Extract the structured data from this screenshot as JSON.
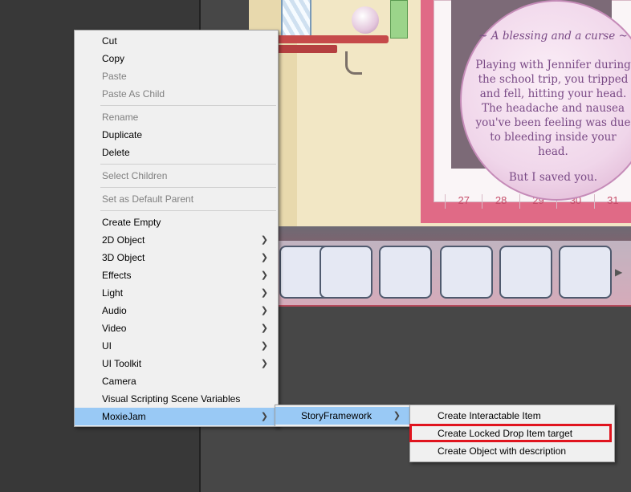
{
  "scene": {
    "calendar_days": [
      "27",
      "28",
      "29",
      "30",
      "31"
    ],
    "blessing": {
      "title": "~ A blessing and a curse ~",
      "body": "Playing with Jennifer during the school trip, you tripped and fell, hitting your head. The headache and nausea you've been feeling was due to bleeding inside your head.",
      "closing": "But I saved you."
    }
  },
  "context_menu": {
    "items": [
      {
        "label": "Cut",
        "enabled": true,
        "submenu": false
      },
      {
        "label": "Copy",
        "enabled": true,
        "submenu": false
      },
      {
        "label": "Paste",
        "enabled": false,
        "submenu": false
      },
      {
        "label": "Paste As Child",
        "enabled": false,
        "submenu": false
      },
      {
        "separator": true
      },
      {
        "label": "Rename",
        "enabled": false,
        "submenu": false
      },
      {
        "label": "Duplicate",
        "enabled": true,
        "submenu": false
      },
      {
        "label": "Delete",
        "enabled": true,
        "submenu": false
      },
      {
        "separator": true
      },
      {
        "label": "Select Children",
        "enabled": false,
        "submenu": false
      },
      {
        "separator": true
      },
      {
        "label": "Set as Default Parent",
        "enabled": false,
        "submenu": false
      },
      {
        "separator": true
      },
      {
        "label": "Create Empty",
        "enabled": true,
        "submenu": false
      },
      {
        "label": "2D Object",
        "enabled": true,
        "submenu": true
      },
      {
        "label": "3D Object",
        "enabled": true,
        "submenu": true
      },
      {
        "label": "Effects",
        "enabled": true,
        "submenu": true
      },
      {
        "label": "Light",
        "enabled": true,
        "submenu": true
      },
      {
        "label": "Audio",
        "enabled": true,
        "submenu": true
      },
      {
        "label": "Video",
        "enabled": true,
        "submenu": true
      },
      {
        "label": "UI",
        "enabled": true,
        "submenu": true
      },
      {
        "label": "UI Toolkit",
        "enabled": true,
        "submenu": true
      },
      {
        "label": "Camera",
        "enabled": true,
        "submenu": false
      },
      {
        "label": "Visual Scripting Scene Variables",
        "enabled": true,
        "submenu": false
      },
      {
        "label": "MoxieJam",
        "enabled": true,
        "submenu": true,
        "active": true
      }
    ]
  },
  "submenu_moxiejam": {
    "items": [
      {
        "label": "StoryFramework",
        "enabled": true,
        "submenu": true,
        "active": true
      }
    ]
  },
  "submenu_storyframework": {
    "items": [
      {
        "label": "Create Interactable Item",
        "enabled": true,
        "submenu": false
      },
      {
        "label": "Create Locked Drop Item target",
        "enabled": true,
        "submenu": false,
        "highlighted": true
      },
      {
        "label": "Create Object with description",
        "enabled": true,
        "submenu": false
      }
    ]
  },
  "colors": {
    "menu_background": "#f0f0f0",
    "menu_active": "#99c9f5",
    "highlight_outline": "#e0141e",
    "disabled_text": "#808080"
  },
  "icons": {
    "submenu_arrow": "chevron-right-icon"
  }
}
